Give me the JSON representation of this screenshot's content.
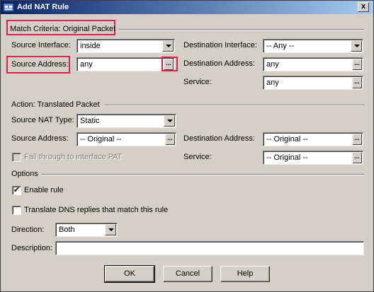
{
  "window": {
    "title": "Add NAT Rule",
    "close_label": "x"
  },
  "match_criteria": {
    "section_title": "Match Criteria: Original Packet",
    "source_interface_label": "Source Interface:",
    "source_interface_value": "inside",
    "source_address_label": "Source Address:",
    "source_address_value": "any",
    "destination_interface_label": "Destination Interface:",
    "destination_interface_value": "-- Any --",
    "destination_address_label": "Destination Address:",
    "destination_address_value": "any",
    "service_label": "Service:",
    "service_value": "any"
  },
  "action": {
    "section_title": "Action: Translated Packet",
    "source_nat_type_label": "Source NAT Type:",
    "source_nat_type_value": "Static",
    "source_address_label": "Source Address:",
    "source_address_value": "-- Original --",
    "fall_through_label": "Fall through to interface PAT",
    "destination_address_label": "Destination Address:",
    "destination_address_value": "-- Original --",
    "service_label": "Service:",
    "service_value": "-- Original --"
  },
  "options": {
    "section_title": "Options",
    "enable_rule_label": "Enable rule",
    "enable_rule_checked": true,
    "translate_dns_label": "Translate DNS replies that match this rule",
    "translate_dns_checked": false,
    "direction_label": "Direction:",
    "direction_value": "Both",
    "description_label": "Description:",
    "description_value": ""
  },
  "buttons": {
    "ok": "OK",
    "cancel": "Cancel",
    "help": "Help"
  },
  "browse_label": "...",
  "check_mark": "✔",
  "highlight_color": "#e0204a"
}
